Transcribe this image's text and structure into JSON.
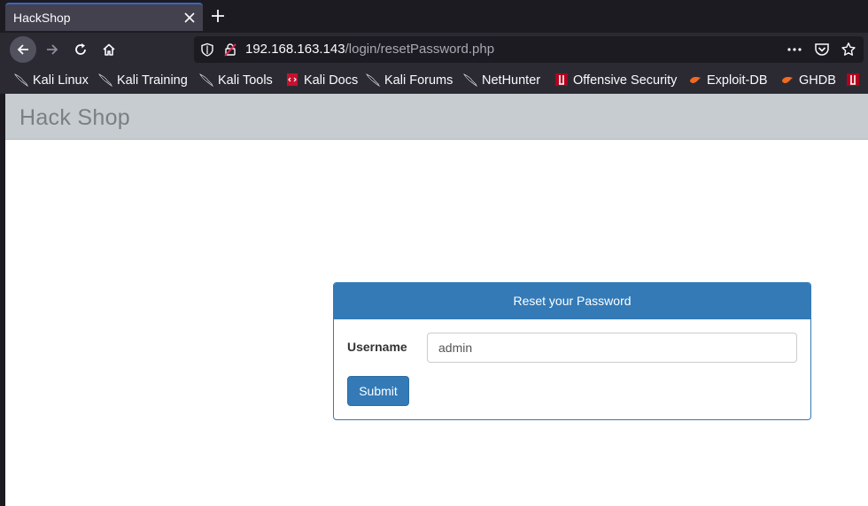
{
  "browser": {
    "tab_title": "HackShop",
    "url_host": "192.168.163.143",
    "url_path": "/login/resetPassword.php",
    "accent": "#3a66c4"
  },
  "bookmarks": [
    {
      "label": "Kali Linux",
      "icon": "kali-dragon-icon"
    },
    {
      "label": "Kali Training",
      "icon": "kali-dragon-icon"
    },
    {
      "label": "Kali Tools",
      "icon": "kali-dragon-icon"
    },
    {
      "label": "Kali Docs",
      "icon": "kali-docs-icon"
    },
    {
      "label": "Kali Forums",
      "icon": "kali-dragon-icon"
    },
    {
      "label": "NetHunter",
      "icon": "kali-dragon-icon"
    },
    {
      "label": "Offensive Security",
      "icon": "offsec-icon"
    },
    {
      "label": "Exploit-DB",
      "icon": "exploitdb-icon"
    },
    {
      "label": "GHDB",
      "icon": "exploitdb-icon"
    }
  ],
  "page": {
    "brand": "Hack Shop",
    "panel_title": "Reset your Password",
    "username_label": "Username",
    "username_value": "admin",
    "submit_label": "Submit",
    "primary_color": "#337ab7"
  }
}
